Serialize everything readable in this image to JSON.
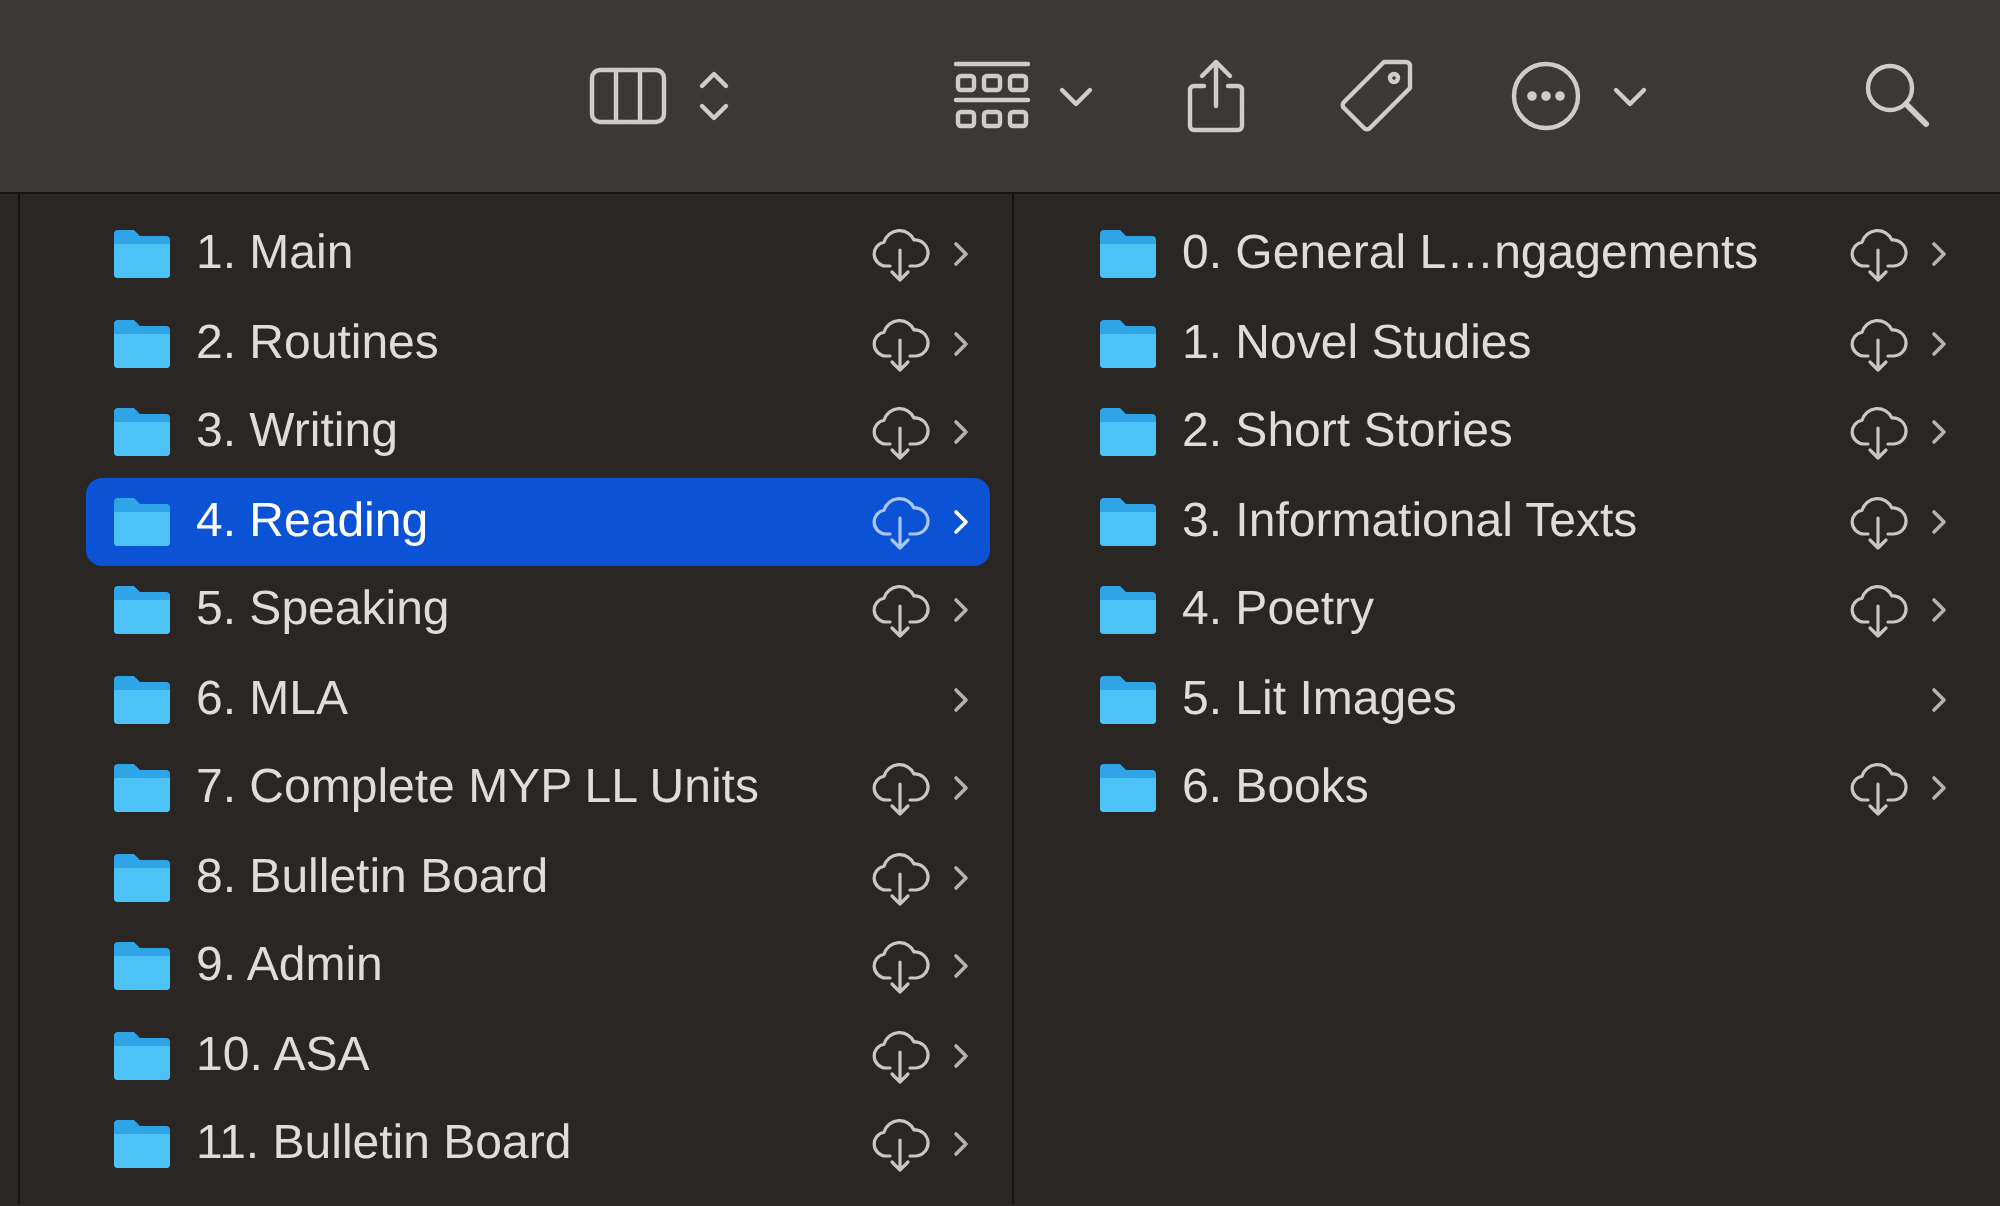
{
  "columns": [
    {
      "items": [
        {
          "name": "1. Main",
          "cloud": true,
          "selected": false
        },
        {
          "name": "2. Routines",
          "cloud": true,
          "selected": false
        },
        {
          "name": "3. Writing",
          "cloud": true,
          "selected": false
        },
        {
          "name": "4. Reading",
          "cloud": true,
          "selected": true
        },
        {
          "name": "5. Speaking",
          "cloud": true,
          "selected": false
        },
        {
          "name": "6. MLA",
          "cloud": false,
          "selected": false
        },
        {
          "name": "7. Complete MYP LL Units",
          "cloud": true,
          "selected": false
        },
        {
          "name": "8. Bulletin Board",
          "cloud": true,
          "selected": false
        },
        {
          "name": "9. Admin",
          "cloud": true,
          "selected": false
        },
        {
          "name": "10. ASA",
          "cloud": true,
          "selected": false
        },
        {
          "name": "11. Bulletin Board",
          "cloud": true,
          "selected": false
        }
      ]
    },
    {
      "items": [
        {
          "name": "0. General L…ngagements",
          "cloud": true,
          "selected": false
        },
        {
          "name": "1. Novel Studies",
          "cloud": true,
          "selected": false
        },
        {
          "name": "2. Short Stories",
          "cloud": true,
          "selected": false
        },
        {
          "name": "3. Informational Texts",
          "cloud": true,
          "selected": false
        },
        {
          "name": "4. Poetry",
          "cloud": true,
          "selected": false
        },
        {
          "name": "5. Lit Images",
          "cloud": false,
          "selected": false
        },
        {
          "name": "6. Books",
          "cloud": true,
          "selected": false
        }
      ]
    }
  ]
}
